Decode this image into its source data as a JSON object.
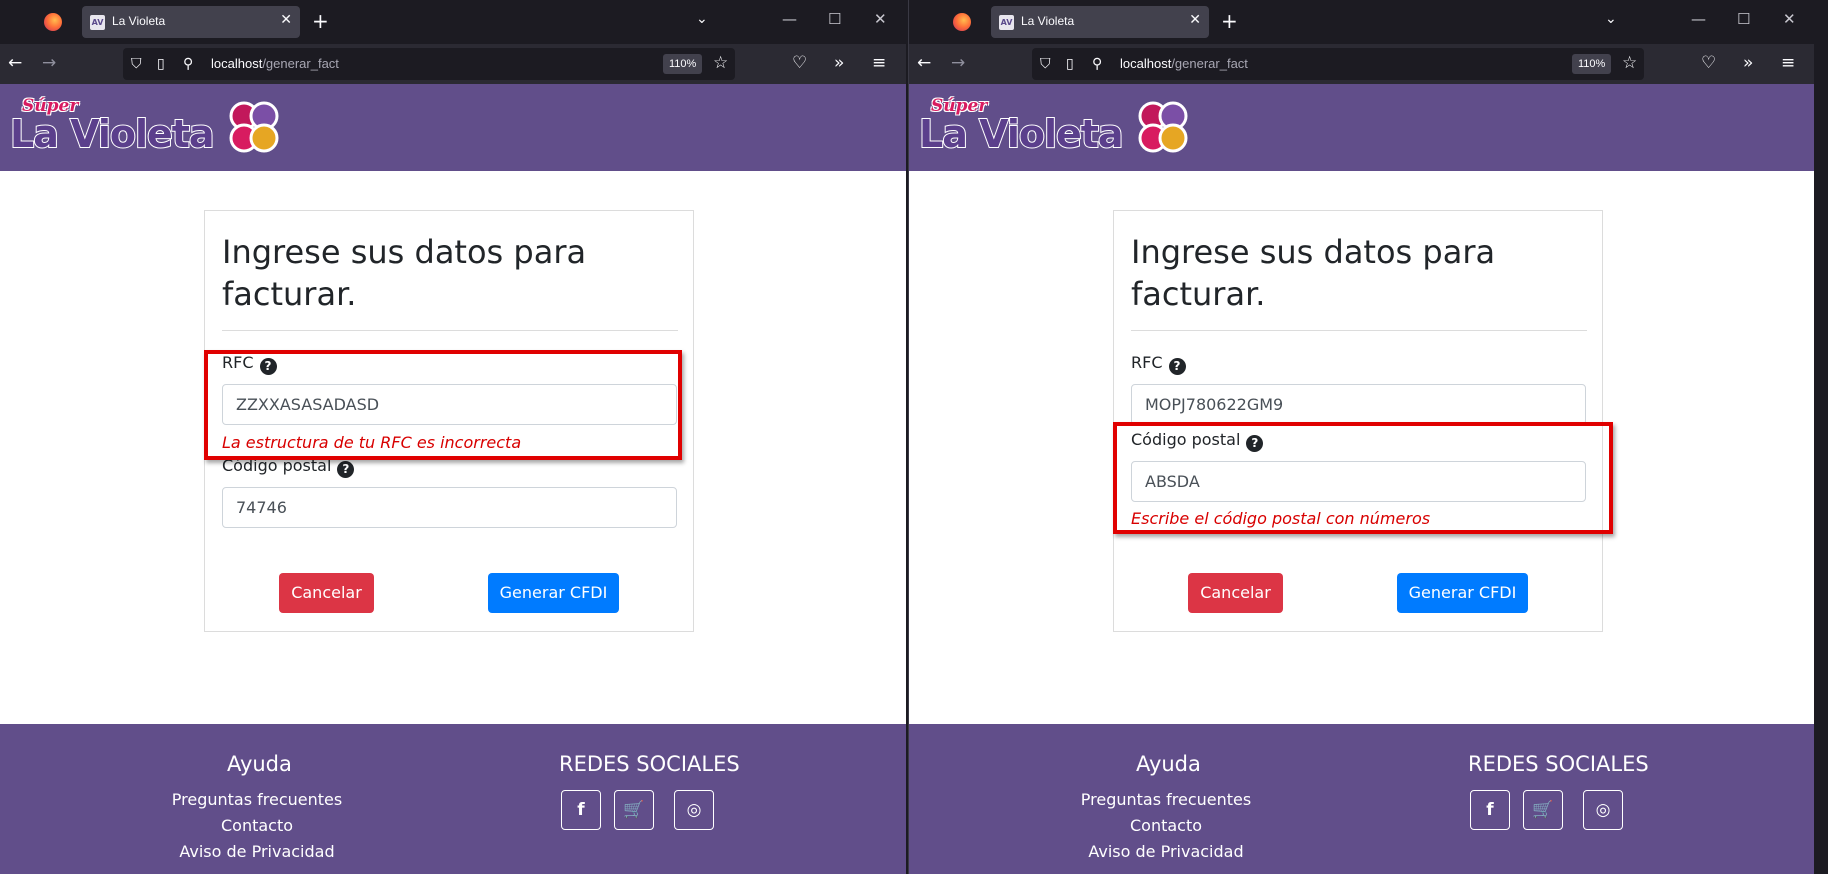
{
  "browser": {
    "tab_title": "La Violeta",
    "tab_close": "✕",
    "new_tab": "+",
    "tab_list": "⌄",
    "window_controls": {
      "minimize": "—",
      "maximize": "☐",
      "close": "✕"
    },
    "nav": {
      "back": "←",
      "forward": "→",
      "reload_icon": "shield-icon",
      "pocket": "♡",
      "extensions": "»",
      "menu": "≡"
    },
    "url_host": "localhost",
    "url_path": "/generar_fact",
    "zoom": "110%",
    "star": "☆"
  },
  "site": {
    "logo_super": "Súper",
    "logo_main": "La Violeta",
    "form_title": "Ingrese sus datos para facturar.",
    "rfc_label": "RFC",
    "cp_label": "Código postal",
    "help_glyph": "?",
    "cancel_label": "Cancelar",
    "generate_label": "Generar CFDI",
    "footer": {
      "help_heading": "Ayuda",
      "links": [
        "Preguntas frecuentes",
        "Contacto",
        "Aviso de Privacidad"
      ],
      "social_heading": "REDES SOCIALES",
      "social": [
        {
          "name": "facebook-icon",
          "glyph": "f"
        },
        {
          "name": "cart-icon",
          "glyph": "🛒"
        },
        {
          "name": "instagram-icon",
          "glyph": "◎"
        }
      ]
    }
  },
  "windows": [
    {
      "rfc_value": "ZZXXASASADASD",
      "rfc_error": "La estructura de tu RFC es incorrecta",
      "cp_value": "74746",
      "cp_error": ""
    },
    {
      "rfc_value": "MOPJ780622GM9",
      "rfc_error": "",
      "cp_value": "ABSDA",
      "cp_error": "Escribe el código postal con números"
    }
  ],
  "colors": {
    "brand_purple": "#614e8a",
    "cancel_red": "#dc3545",
    "primary_blue": "#007bff",
    "error_red": "#d80000",
    "highlight_red": "#e00000"
  }
}
